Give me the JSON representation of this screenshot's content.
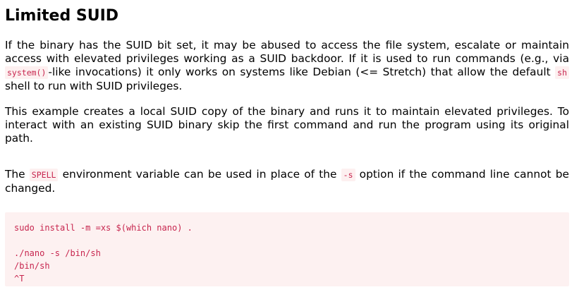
{
  "heading": "Limited SUID",
  "para1": {
    "t1": "If the binary has the SUID bit set, it may be abused to access the file system, escalate or maintain access with elevated privileges working as a SUID backdoor. If it is used to run commands (e.g., via ",
    "c1": "system()",
    "t2": "-like invocations) it only works on systems like Debian (<= Stretch) that allow the default ",
    "c2": "sh",
    "t3": " shell to run with SUID privileges."
  },
  "para2": "This example creates a local SUID copy of the binary and runs it to maintain elevated privileges. To interact with an existing SUID binary skip the first command and run the program using its original path.",
  "para3": {
    "t1": "The ",
    "c1": "SPELL",
    "t2": " environment variable can be used in place of the ",
    "c2": "-s",
    "t3": " option if the command line cannot be changed."
  },
  "code_block": {
    "line1": "sudo install -m =xs $(which nano) .",
    "line2": "",
    "line3": "./nano -s /bin/sh",
    "line4": "/bin/sh",
    "line5": "^T"
  }
}
